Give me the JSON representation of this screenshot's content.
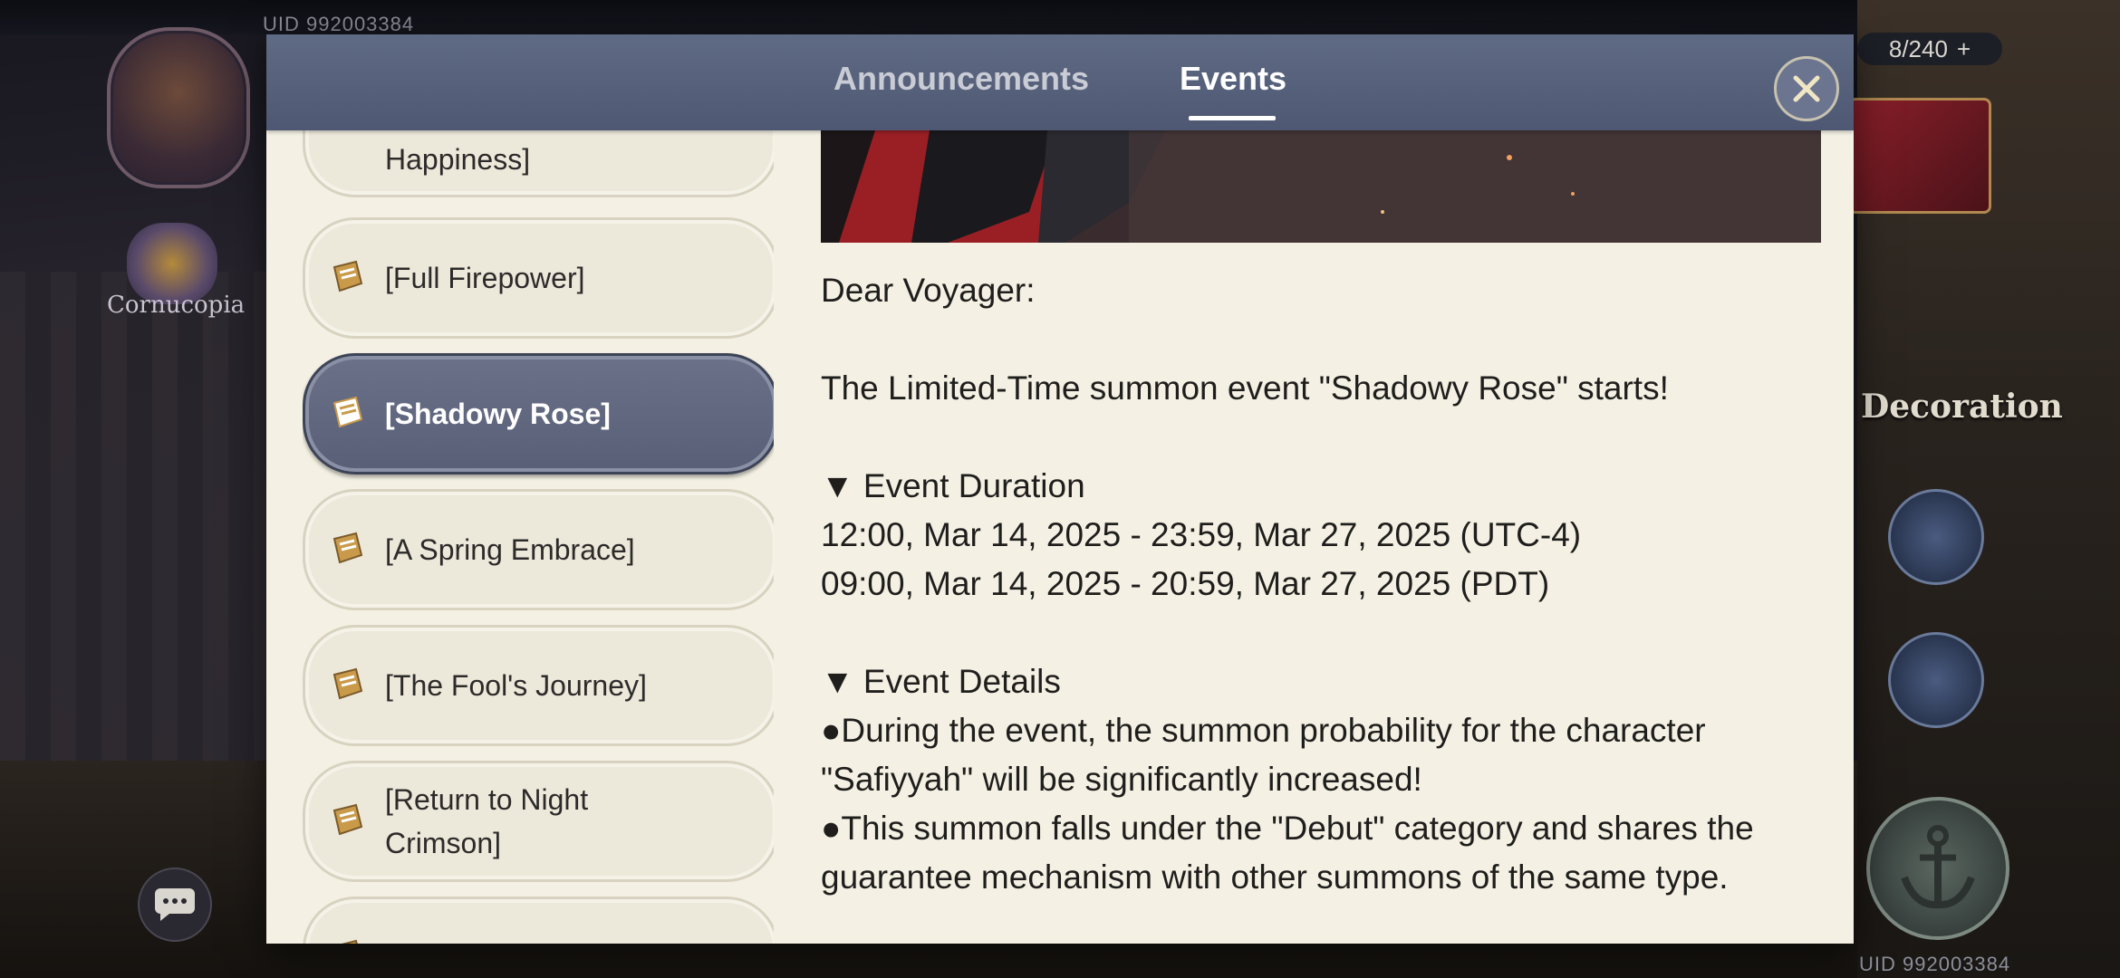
{
  "background": {
    "uid_top": "UID 992003384",
    "uid_bottom": "UID 992003384",
    "cornucopia_label": "Cornucopia",
    "counter": "8/240",
    "counter_add": "+",
    "decoration_label": "Decoration"
  },
  "modal": {
    "tabs": [
      {
        "label": "Announcements",
        "active": false
      },
      {
        "label": "Events",
        "active": true
      }
    ],
    "close_icon": "close-icon"
  },
  "event_list": {
    "items": [
      {
        "label": "Happiness]",
        "selected": false
      },
      {
        "label": "[Full Firepower]",
        "selected": false
      },
      {
        "label": "[Shadowy Rose]",
        "selected": true
      },
      {
        "label": "[A Spring Embrace]",
        "selected": false
      },
      {
        "label": "[The Fool's Journey]",
        "selected": false
      },
      {
        "label": "[Return to Night Crimson]",
        "selected": false
      }
    ]
  },
  "content": {
    "greeting": "Dear Voyager:",
    "intro": "The Limited-Time summon event \"Shadowy Rose\" starts!",
    "duration_heading": "▼ Event Duration",
    "duration_line1": "12:00, Mar 14, 2025 - 23:59, Mar 27, 2025 (UTC-4)",
    "duration_line2": "09:00, Mar 14, 2025 - 20:59, Mar 27, 2025 (PDT)",
    "details_heading": "▼ Event Details",
    "detail1": "●During the event, the summon probability for the character \"Safiyyah\" will be significantly increased!",
    "detail2": "●This summon falls under the \"Debut\" category and shares the guarantee mechanism with other summons of the same type."
  },
  "colors": {
    "header": "#5a6480",
    "panel": "#f4f1e4",
    "selected_item": "#626980",
    "item": "#ece8da"
  }
}
